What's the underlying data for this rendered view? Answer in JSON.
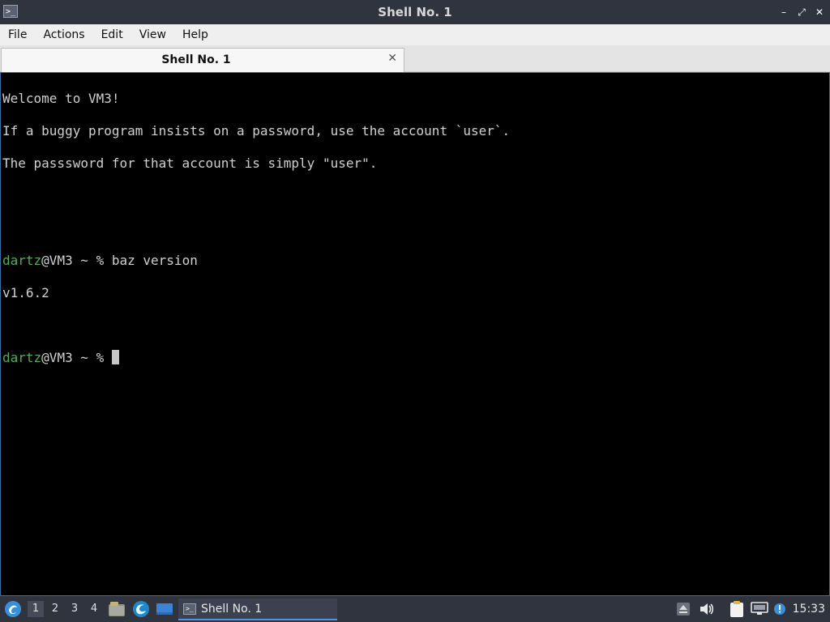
{
  "window": {
    "title": "Shell No. 1",
    "app_icon": "terminal-icon",
    "controls": {
      "minimize": "–",
      "maximize": "⤢",
      "close": "✕"
    }
  },
  "menu": [
    "File",
    "Actions",
    "Edit",
    "View",
    "Help"
  ],
  "tabs": [
    {
      "label": "Shell No. 1",
      "close": "✕"
    }
  ],
  "terminal": {
    "welcome": [
      "Welcome to VM3!",
      "If a buggy program insists on a password, use the account `user`.",
      "The passsword for that account is simply \"user\"."
    ],
    "prompt1": {
      "user": "dartz",
      "rest": "@VM3 ~ % baz version"
    },
    "output": "v1.6.2",
    "prompt2": {
      "user": "dartz",
      "rest": "@VM3 ~ % "
    }
  },
  "taskbar": {
    "launcher_icon": "start-menu-icon",
    "desktops": [
      "1",
      "2",
      "3",
      "4"
    ],
    "active_desktop": "1",
    "quicklaunch": [
      "file-manager-icon",
      "browser-icon",
      "show-desktop-icon"
    ],
    "task": {
      "label": "Shell No. 1",
      "icon": "terminal-icon"
    },
    "tray": [
      "eject-icon",
      "volume-icon",
      "clipboard-icon",
      "network-icon",
      "updates-icon"
    ],
    "clock": "15:33"
  },
  "colors": {
    "prompt_user": "#4fb04f",
    "panel_bg": "#2f343f",
    "accent": "#5294e2"
  }
}
